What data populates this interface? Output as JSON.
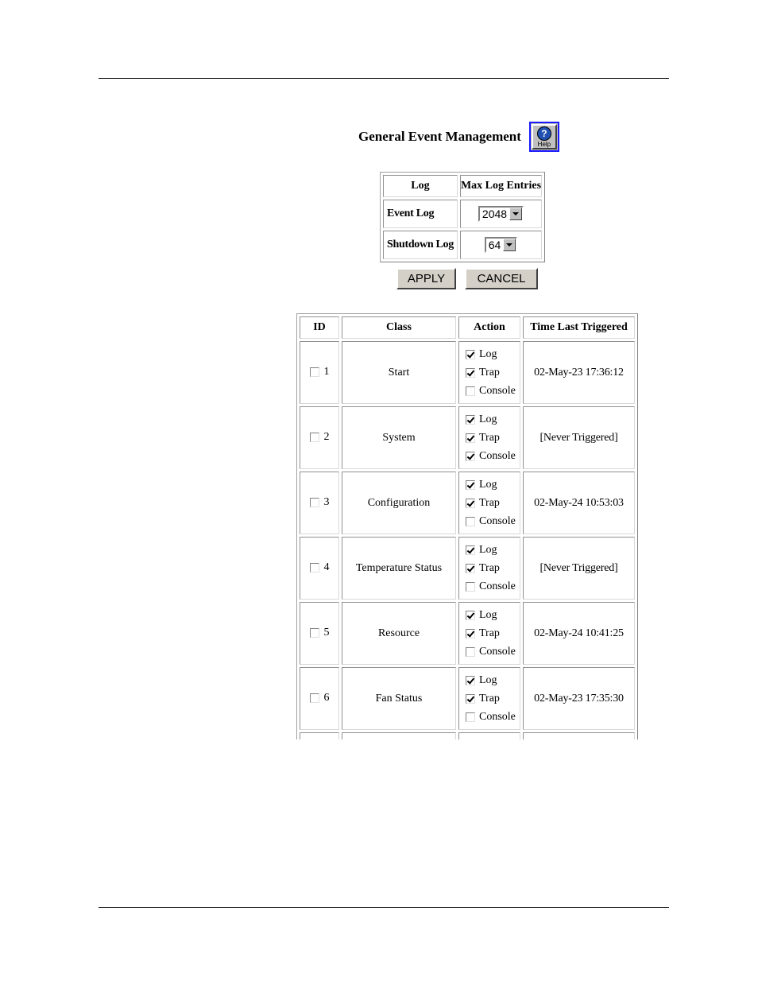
{
  "page": {
    "title": "General Event Management",
    "help_label": "Help"
  },
  "log_table": {
    "headers": [
      "Log",
      "Max Log Entries"
    ],
    "rows": [
      {
        "label": "Event Log",
        "value": "2048"
      },
      {
        "label": "Shutdown Log",
        "value": "64"
      }
    ]
  },
  "buttons": {
    "apply": "APPLY",
    "cancel": "CANCEL"
  },
  "event_table": {
    "headers": [
      "ID",
      "Class",
      "Action",
      "Time Last Triggered"
    ],
    "action_labels": [
      "Log",
      "Trap",
      "Console"
    ],
    "rows": [
      {
        "id": "1",
        "class": "Start",
        "selected": false,
        "log": true,
        "trap": true,
        "console": false,
        "time": "02-May-23 17:36:12"
      },
      {
        "id": "2",
        "class": "System",
        "selected": false,
        "log": true,
        "trap": true,
        "console": true,
        "time": "[Never Triggered]"
      },
      {
        "id": "3",
        "class": "Configuration",
        "selected": false,
        "log": true,
        "trap": true,
        "console": false,
        "time": "02-May-24 10:53:03"
      },
      {
        "id": "4",
        "class": "Temperature Status",
        "selected": false,
        "log": true,
        "trap": true,
        "console": false,
        "time": "[Never Triggered]"
      },
      {
        "id": "5",
        "class": "Resource",
        "selected": false,
        "log": true,
        "trap": true,
        "console": false,
        "time": "02-May-24 10:41:25"
      },
      {
        "id": "6",
        "class": "Fan Status",
        "selected": false,
        "log": true,
        "trap": true,
        "console": false,
        "time": "02-May-23 17:35:30"
      }
    ]
  }
}
